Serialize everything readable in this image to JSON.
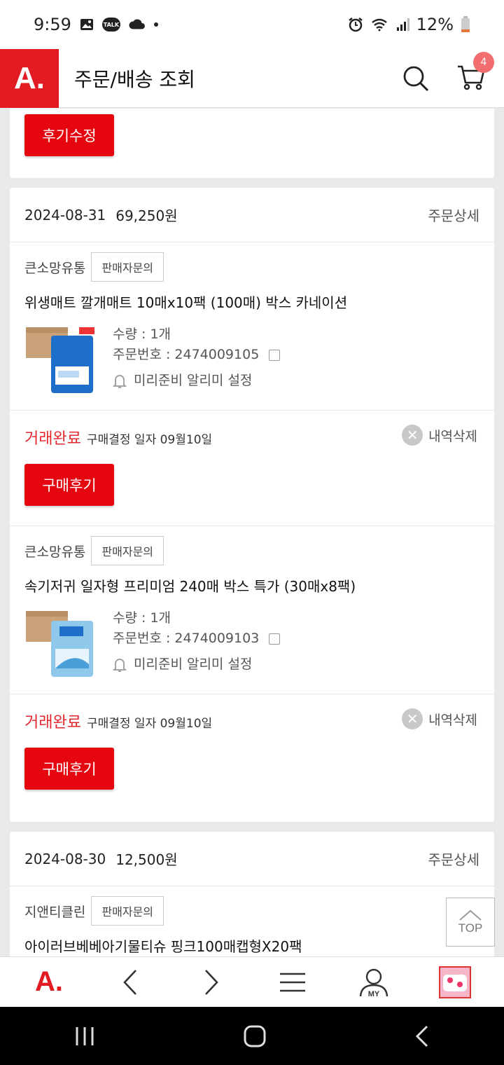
{
  "status_bar": {
    "time": "9:59",
    "talk_label": "TALK",
    "battery": "12%"
  },
  "header": {
    "logo": "A.",
    "title": "주문/배송 조회",
    "cart_count": "4"
  },
  "top_card": {
    "review_edit_label": "후기수정"
  },
  "orders": [
    {
      "date": "2024-08-31",
      "total": "69,250원",
      "detail_label": "주문상세",
      "items": [
        {
          "seller": "큰소망유통",
          "inquiry_label": "판매자문의",
          "name": "위생매트 깔개매트 10매x10팩 (100매) 박스 카네이션",
          "qty": "수량 : 1개",
          "order_no": "주문번호 : 2474009105",
          "alarm": "미리준비 알리미 설정",
          "status": "거래완료",
          "status_sub": "구매결정 일자 09월10일",
          "delete_label": "내역삭제",
          "review_label": "구매후기"
        },
        {
          "seller": "큰소망유통",
          "inquiry_label": "판매자문의",
          "name": "속기저귀 일자형 프리미엄 240매 박스 특가 (30매x8팩)",
          "qty": "수량 : 1개",
          "order_no": "주문번호 : 2474009103",
          "alarm": "미리준비 알리미 설정",
          "status": "거래완료",
          "status_sub": "구매결정 일자 09월10일",
          "delete_label": "내역삭제",
          "review_label": "구매후기"
        }
      ]
    },
    {
      "date": "2024-08-30",
      "total": "12,500원",
      "detail_label": "주문상세",
      "items": [
        {
          "seller": "지앤티클린",
          "inquiry_label": "판매자문의",
          "name": "아이러브베베아기물티슈 핑크100매캡형X20팩"
        }
      ]
    }
  ],
  "top_button": "TOP",
  "bottom_nav": {
    "logo": "A.",
    "my_label": "MY"
  },
  "colors": {
    "brand_red": "#e21a22",
    "button_red": "#e5060f",
    "status_red": "#e5282f",
    "badge": "#f26d6d"
  }
}
